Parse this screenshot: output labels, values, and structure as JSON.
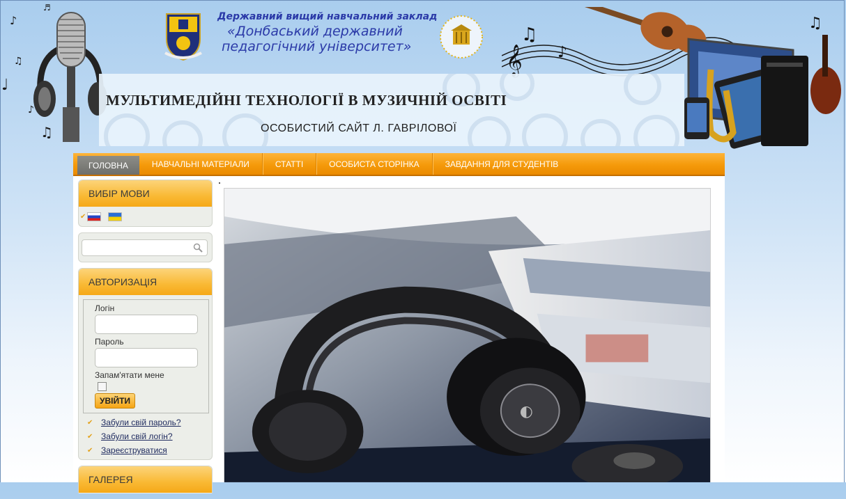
{
  "header": {
    "university_line1": "Державний вищий навчальний заклад",
    "university_line2": "«Донбаський державний",
    "university_line3": "педагогічний університет»",
    "site_title": "МУЛЬТИМЕДІЙНІ ТЕХНОЛОГІЇ В МУЗИЧНІЙ ОСВІТІ",
    "site_subtitle": "ОСОБИСТИЙ САЙТ Л. ГАВРІЛОВОЇ"
  },
  "nav": {
    "items": [
      {
        "label": "ГОЛОВНА",
        "active": true
      },
      {
        "label": "НАВЧАЛЬНІ МАТЕРІАЛИ",
        "active": false
      },
      {
        "label": "СТАТТІ",
        "active": false
      },
      {
        "label": "ОСОБИСТА СТОРІНКА",
        "active": false
      },
      {
        "label": "ЗАВДАННЯ ДЛЯ СТУДЕНТІВ",
        "active": false
      }
    ]
  },
  "language_module": {
    "title": "ВИБІР МОВИ",
    "flags": [
      "russian-flag",
      "ukrainian-flag"
    ]
  },
  "search": {
    "value": "",
    "placeholder": ""
  },
  "login_module": {
    "title": "АВТОРИЗАЦІЯ",
    "login_label": "Логін",
    "password_label": "Пароль",
    "remember_label": "Запам'ятати мене",
    "submit_label": "УВІЙТИ",
    "links": [
      "Забули свій пароль?",
      "Забули свій логін?",
      "Зареєструватися"
    ]
  },
  "gallery_module": {
    "title": "ГАЛЕРЕЯ"
  },
  "colors": {
    "nav_orange": "#f59a0a",
    "nav_active": "#6e6f6b",
    "module_header": "#f9b934",
    "title_blue": "#2b3aa8"
  }
}
